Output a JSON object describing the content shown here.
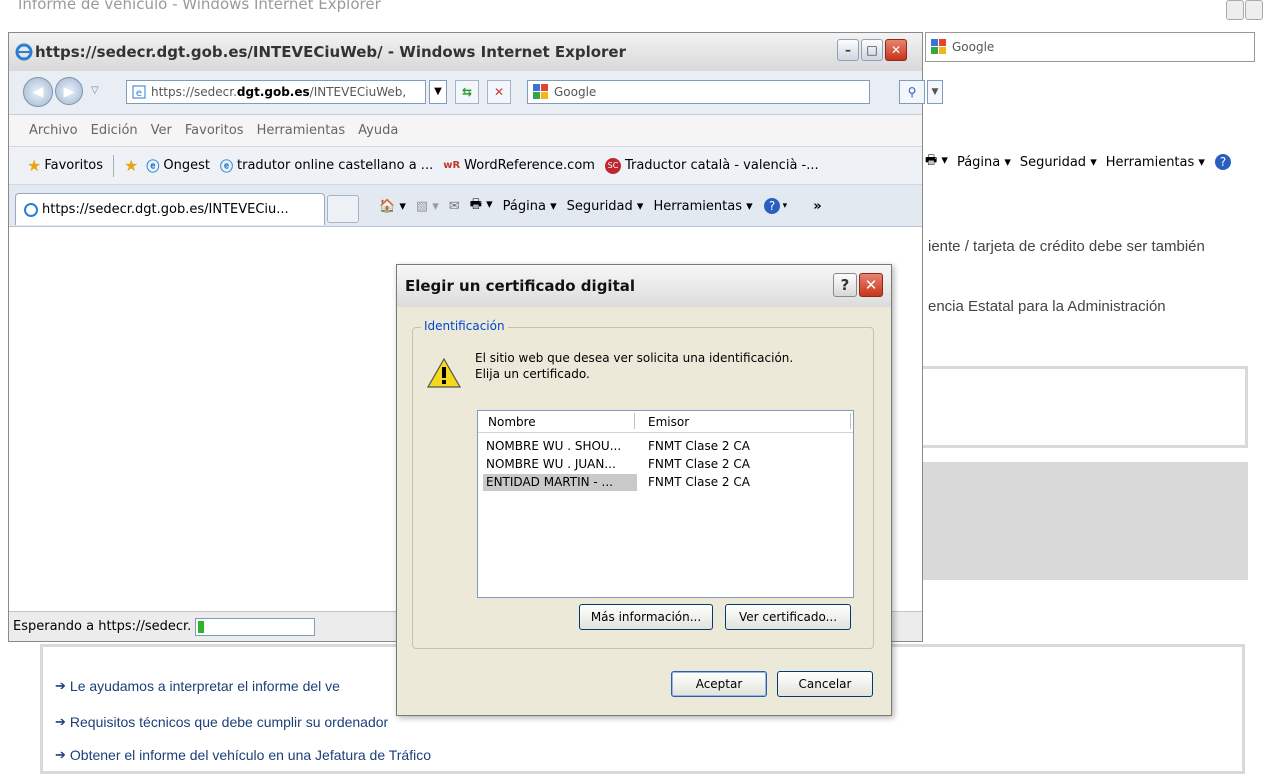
{
  "background": {
    "window_title": "Informe de vehículo - Windows Internet Explorer",
    "search_text": "Google",
    "toolbar": {
      "page": "Página ▾",
      "security": "Seguridad ▾",
      "tools": "Herramientas ▾"
    },
    "text_line1": "iente / tarjeta de crédito debe ser también",
    "text_line2": "encia Estatal para la Administración",
    "links": [
      "Le ayudamos a interpretar el informe del ve",
      "Requisitos técnicos que debe cumplir su ordenador",
      "Obtener el informe del vehículo en una Jefatura de Tráfico"
    ]
  },
  "ie_window": {
    "title": "https://sedecr.dgt.gob.es/INTEVECiuWeb/ - Windows Internet Explorer",
    "url_prefix": "https://sedecr.",
    "url_domain": "dgt.gob.es",
    "url_suffix": "/INTEVECiuWeb,",
    "search_placeholder": "Google",
    "menu": [
      "Archivo",
      "Edición",
      "Ver",
      "Favoritos",
      "Herramientas",
      "Ayuda"
    ],
    "favorites_label": "Favoritos",
    "favorites": [
      "Ongest",
      "tradutor online castellano a ...",
      "WordReference.com",
      "Traductor català - valencià -..."
    ],
    "tab_title": "https://sedecr.dgt.gob.es/INTEVECiu...",
    "commands": {
      "page": "Página ▾",
      "security": "Seguridad ▾",
      "tools": "Herramientas ▾"
    },
    "status_text": "Esperando a https://sedecr.",
    "progress_fraction": 0.05
  },
  "dialog": {
    "title": "Elegir un certificado digital",
    "group_label": "Identificación",
    "message_line1": "El sitio web que desea ver solicita una identificación.",
    "message_line2": "Elija un certificado.",
    "columns": [
      "Nombre",
      "Emisor"
    ],
    "rows": [
      {
        "name": "NOMBRE WU . SHOU...",
        "issuer": "FNMT Clase 2 CA"
      },
      {
        "name": "NOMBRE WU . JUAN...",
        "issuer": "FNMT Clase 2 CA"
      },
      {
        "name": "ENTIDAD MARTIN - ...",
        "issuer": "FNMT Clase 2 CA"
      }
    ],
    "more_info_label": "Más información...",
    "view_cert_label": "Ver certificado...",
    "accept_label": "Aceptar",
    "cancel_label": "Cancelar"
  },
  "colors": {
    "accent": "#0046d5",
    "close_red": "#d9442c",
    "link": "#1c3f7a"
  },
  "icons": [
    "ie-icon",
    "back-icon",
    "forward-icon",
    "refresh-icon",
    "stop-icon",
    "search-icon",
    "star-icon",
    "home-icon",
    "rss-icon",
    "mail-icon",
    "print-icon",
    "help-icon",
    "warning-icon",
    "help-question-icon",
    "close-icon",
    "minimize-icon",
    "maximize-icon"
  ]
}
